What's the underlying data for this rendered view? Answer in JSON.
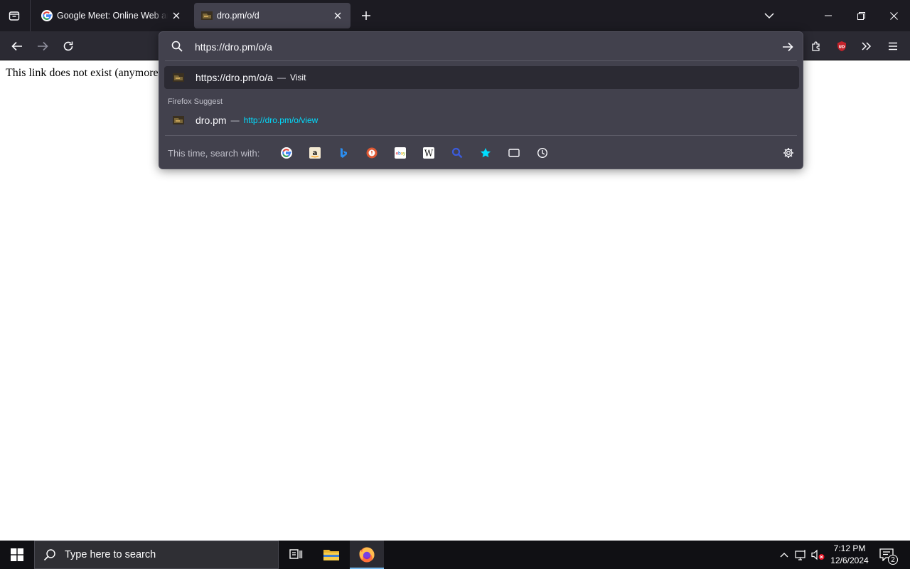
{
  "tabs": [
    {
      "title": "Google Meet: Online Web and Video Calling",
      "favicon": "google-icon",
      "active": false
    },
    {
      "title": "dro.pm/o/d",
      "favicon": "dropm-icon",
      "active": true
    }
  ],
  "page": {
    "body_text": "This link does not exist (anymore"
  },
  "urlbar": {
    "value": "https://dro.pm/o/a",
    "results": [
      {
        "title": "https://dro.pm/o/a",
        "separator": "—",
        "action": "Visit",
        "selected": true
      },
      {
        "title": "dro.pm",
        "separator": "—",
        "url": "http://dro.pm/o/view"
      }
    ],
    "group_label": "Firefox Suggest",
    "oneoff_label": "This time, search with:",
    "engines": [
      "google-icon",
      "amazon-icon",
      "bing-icon",
      "duckduckgo-icon",
      "ebay-icon",
      "wikipedia-icon",
      "search-icon",
      "bookmarks-star-icon",
      "tabs-icon",
      "history-icon"
    ]
  },
  "taskbar": {
    "search_placeholder": "Type here to search",
    "time": "7:12 PM",
    "date": "12/6/2024",
    "notification_count": "2"
  },
  "colors": {
    "chrome_dark": "#1c1b22",
    "toolbar": "#2b2a33",
    "popup": "#42414d",
    "link_cyan": "#00ddff",
    "ublock_red": "#c4232b"
  }
}
